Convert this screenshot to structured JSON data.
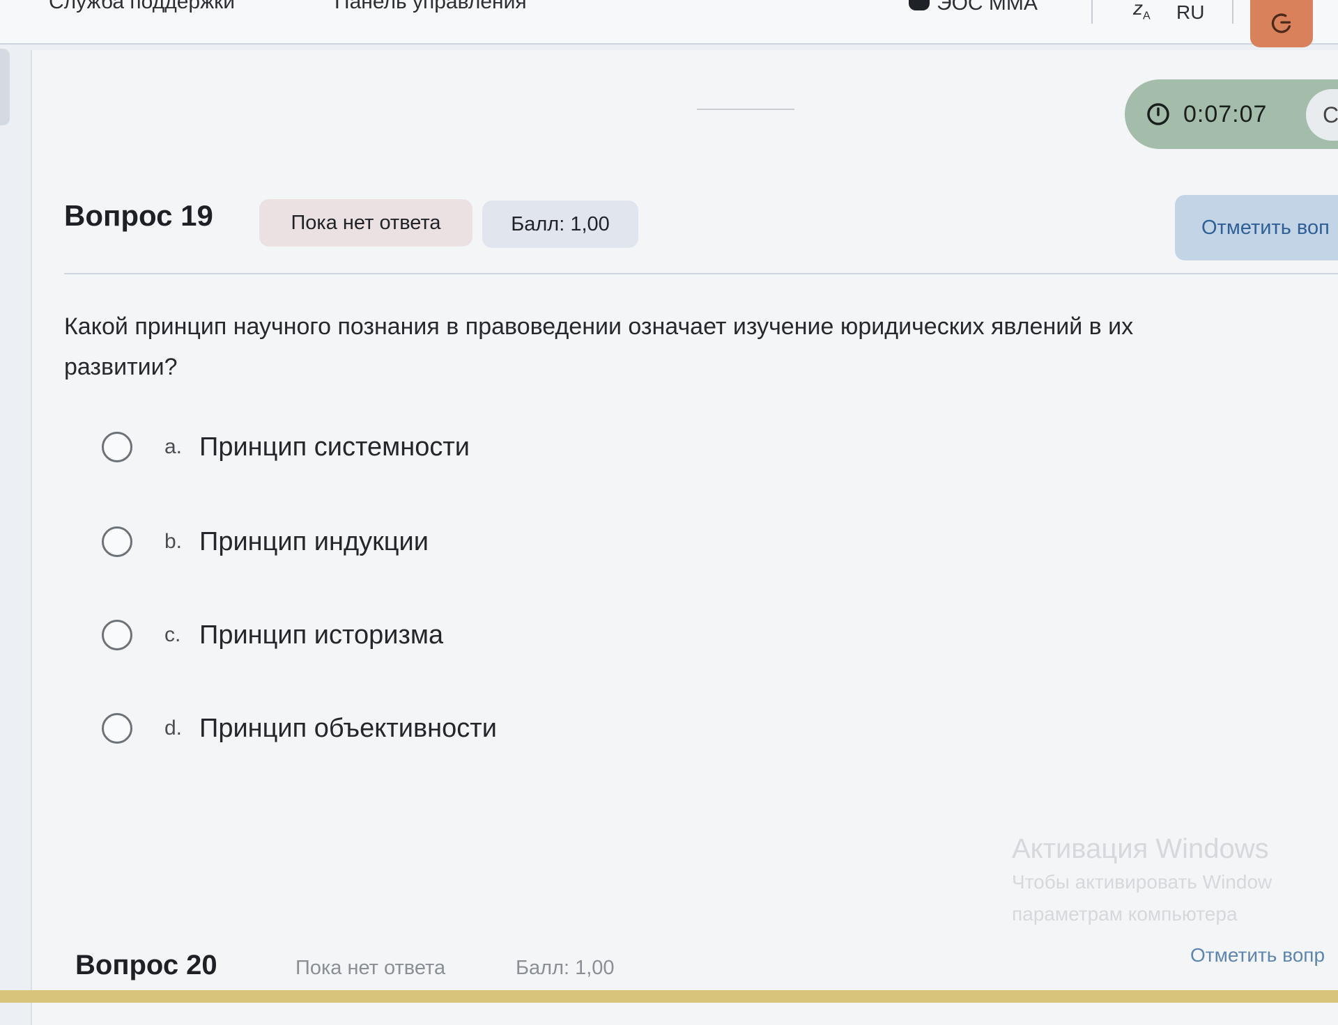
{
  "navbar": {
    "support_label": "Служба поддержки",
    "panel_label": "Панель управления",
    "eos_label": "ЭОС ММА",
    "lang_code": "RU"
  },
  "timer": {
    "value": "0:07:07",
    "pill_text": "С"
  },
  "question": {
    "title": "Вопрос 19",
    "status": "Пока нет ответа",
    "grade": "Балл: 1,00",
    "flag_label": "Отметить воп",
    "text_line1": "Какой принцип научного познания в правоведении означает изучение юридических явлений в их",
    "text_line2": "развитии?",
    "answers": [
      {
        "letter": "a.",
        "text": "Принцип системности"
      },
      {
        "letter": "b.",
        "text": "Принцип индукции"
      },
      {
        "letter": "c.",
        "text": "Принцип историзма"
      },
      {
        "letter": "d.",
        "text": "Принцип объективности"
      }
    ]
  },
  "watermark": {
    "title": "Активация Windows",
    "line1": "Чтобы активировать Window",
    "line2": "параметрам компьютера"
  },
  "next_question": {
    "title": "Вопрос 20",
    "status": "Пока нет ответа",
    "grade": "Балл: 1,00",
    "flag_label": "Отметить вопр"
  },
  "colors": {
    "timer_bg": "#a4bcaa",
    "flag_bg": "#c2d4e6",
    "flag_text": "#2f5f95",
    "theme_button": "#d8815a"
  }
}
